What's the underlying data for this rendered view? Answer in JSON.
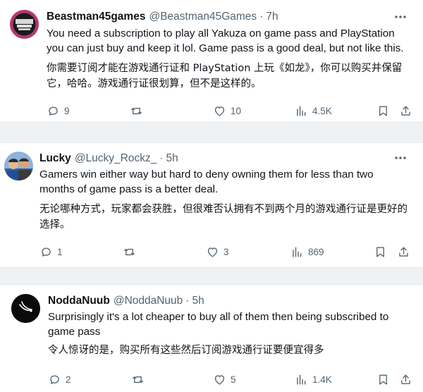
{
  "tweets": [
    {
      "name": "Beastman45games",
      "handle": "@Beastman45Games",
      "separator": "·",
      "time": "7h",
      "avatar_text": "BEASTMAN 45 GAMES",
      "text_en": "You need a subscription to play all Yakuza on game pass and PlayStation you can just buy and keep it lol. Game pass is a good deal, but not like this.",
      "text_zh": "你需要订阅才能在游戏通行证和 PlayStation 上玩《如龙》，你可以购买并保留它，哈哈。游戏通行证很划算，但不是这样的。",
      "replies": "9",
      "retweets": "",
      "likes": "10",
      "views": "4.5K"
    },
    {
      "name": "Lucky",
      "handle": "@Lucky_Rockz_",
      "separator": "·",
      "time": "5h",
      "text_en": "Gamers win either way but hard to deny owning them for less than two months of game pass is a better deal.",
      "text_zh": "无论哪种方式，玩家都会获胜，但很难否认拥有不到两个月的游戏通行证是更好的选择。",
      "replies": "1",
      "retweets": "",
      "likes": "3",
      "views": "869"
    },
    {
      "name": "NoddaNuub",
      "handle": "@NoddaNuub",
      "separator": "·",
      "time": "5h",
      "text_en": "Surprisingly it's a lot cheaper to buy all of them then being subscribed to game pass",
      "text_zh": "令人惊讶的是，购买所有这些然后订阅游戏通行证要便宜得多",
      "replies": "2",
      "retweets": "",
      "likes": "5",
      "views": "1.4K"
    }
  ],
  "icons": {
    "more": "more-icon",
    "reply": "reply-icon",
    "retweet": "retweet-icon",
    "like": "heart-icon",
    "views": "views-icon",
    "bookmark": "bookmark-icon",
    "share": "share-icon"
  },
  "colors": {
    "page_background": "#eff1f3",
    "card_background": "#ffffff",
    "primary_text": "#0f1419",
    "secondary_text": "#536471",
    "avatar0_bg": "#b23a6d",
    "avatar2_bg": "#0b0b0b"
  }
}
